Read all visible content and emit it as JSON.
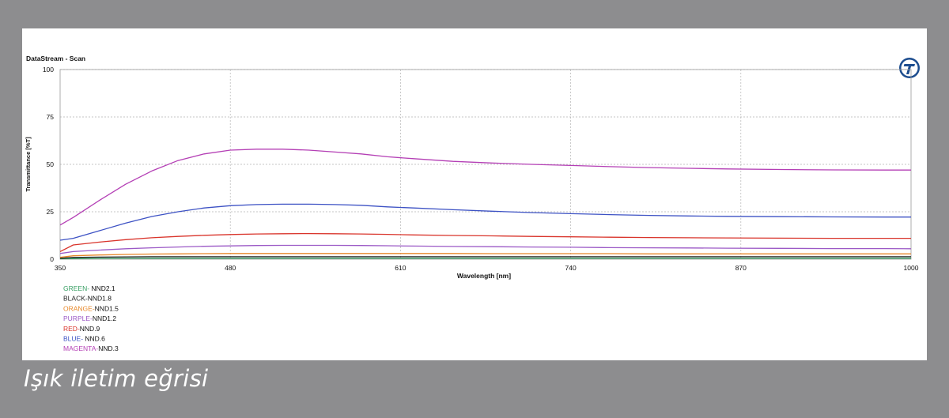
{
  "caption": "Işık iletim eğrisi",
  "chart_data": {
    "type": "line",
    "title": "DataStream - Scan",
    "xlabel": "Wavelength [nm]",
    "ylabel": "Transmittance [%T]",
    "xlim": [
      350,
      1000
    ],
    "ylim": [
      0,
      100
    ],
    "xticks": [
      350,
      480,
      610,
      740,
      870,
      1000
    ],
    "yticks": [
      0,
      25,
      50,
      75,
      100
    ],
    "grid": true,
    "legend_position": "bottom-left",
    "logo_icon": "t-circle-logo",
    "x": [
      350,
      360,
      380,
      400,
      420,
      440,
      460,
      480,
      500,
      520,
      540,
      560,
      580,
      600,
      620,
      650,
      680,
      710,
      740,
      770,
      800,
      830,
      860,
      900,
      940,
      980,
      1000
    ],
    "series": [
      {
        "name": "GREEN- NND2.1",
        "legend_prefix": "GREEN-",
        "legend_suffix": " NND2.1",
        "color": "#3aa065",
        "values": [
          0.2,
          0.3,
          0.4,
          0.45,
          0.5,
          0.5,
          0.5,
          0.5,
          0.5,
          0.5,
          0.5,
          0.5,
          0.5,
          0.5,
          0.5,
          0.5,
          0.5,
          0.5,
          0.5,
          0.5,
          0.5,
          0.5,
          0.5,
          0.5,
          0.5,
          0.5,
          0.5
        ]
      },
      {
        "name": "BLACK-NND1.8",
        "legend_prefix": "BLACK-",
        "legend_suffix": "NND1.8",
        "color": "#222222",
        "values": [
          0.5,
          0.9,
          1.1,
          1.2,
          1.3,
          1.3,
          1.3,
          1.3,
          1.3,
          1.3,
          1.3,
          1.3,
          1.3,
          1.3,
          1.3,
          1.3,
          1.3,
          1.3,
          1.3,
          1.3,
          1.3,
          1.3,
          1.3,
          1.3,
          1.3,
          1.3,
          1.3
        ]
      },
      {
        "name": "ORANGE-NND1.5",
        "legend_prefix": "ORANGE-",
        "legend_suffix": "NND1.5",
        "color": "#e8882a",
        "values": [
          1.0,
          1.8,
          2.2,
          2.5,
          2.7,
          2.8,
          2.9,
          3.0,
          3.0,
          3.0,
          3.0,
          3.0,
          3.0,
          3.0,
          3.0,
          3.0,
          2.9,
          2.9,
          2.9,
          2.9,
          2.8,
          2.8,
          2.8,
          2.8,
          2.8,
          2.8,
          2.8
        ]
      },
      {
        "name": "PURPLE-NND1.2",
        "legend_prefix": "PURPLE-",
        "legend_suffix": "NND1.2",
        "color": "#9b59c6",
        "values": [
          3.0,
          4.0,
          4.8,
          5.5,
          6.0,
          6.4,
          6.8,
          7.0,
          7.2,
          7.3,
          7.3,
          7.3,
          7.2,
          7.1,
          6.9,
          6.7,
          6.6,
          6.4,
          6.3,
          6.1,
          6.0,
          5.9,
          5.8,
          5.7,
          5.6,
          5.6,
          5.5
        ]
      },
      {
        "name": "RED-NND.9",
        "legend_prefix": "RED-",
        "legend_suffix": "NND.9",
        "color": "#d9342b",
        "values": [
          4.0,
          7.5,
          9.0,
          10.3,
          11.3,
          12.0,
          12.6,
          13.0,
          13.3,
          13.4,
          13.5,
          13.4,
          13.3,
          13.1,
          12.8,
          12.5,
          12.3,
          12.0,
          11.8,
          11.6,
          11.4,
          11.3,
          11.2,
          11.1,
          11.0,
          11.0,
          11.0
        ]
      },
      {
        "name": "BLUE- NND.6",
        "legend_prefix": "BLUE-",
        "legend_suffix": " NND.6",
        "color": "#3d52c4",
        "values": [
          10.0,
          11.0,
          15.0,
          19.0,
          22.5,
          25.0,
          27.0,
          28.2,
          28.8,
          29.0,
          29.0,
          28.8,
          28.4,
          27.6,
          27.0,
          26.1,
          25.3,
          24.6,
          24.0,
          23.5,
          23.1,
          22.8,
          22.6,
          22.4,
          22.3,
          22.2,
          22.2
        ]
      },
      {
        "name": "MAGENTA-NND.3",
        "legend_prefix": "MAGENTA-",
        "legend_suffix": "NND.3",
        "color": "#b43fb5",
        "values": [
          18.0,
          22.0,
          31.0,
          39.5,
          46.5,
          52.0,
          55.5,
          57.5,
          58.0,
          58.0,
          57.5,
          56.5,
          55.5,
          54.0,
          53.0,
          51.6,
          50.7,
          50.0,
          49.4,
          48.8,
          48.3,
          47.9,
          47.6,
          47.3,
          47.1,
          47.0,
          47.0
        ]
      }
    ]
  }
}
